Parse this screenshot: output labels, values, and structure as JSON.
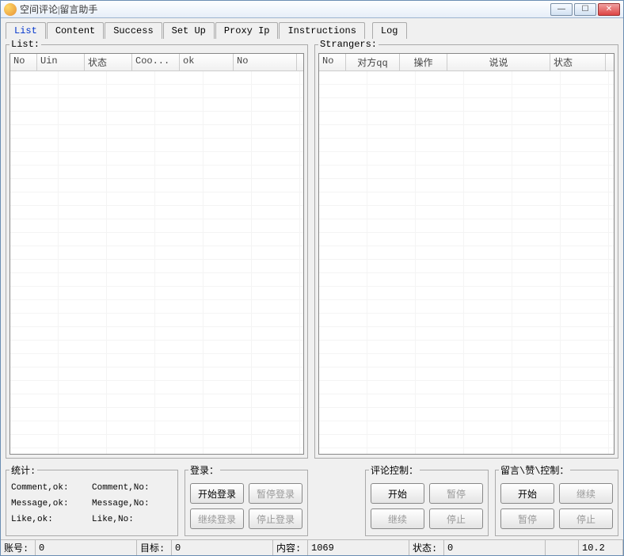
{
  "window": {
    "title": "空间评论|留言助手"
  },
  "tabs": [
    {
      "label": "List",
      "active": true
    },
    {
      "label": "Content"
    },
    {
      "label": "Success"
    },
    {
      "label": "Set Up"
    },
    {
      "label": "Proxy Ip"
    },
    {
      "label": "Instructions"
    },
    {
      "label": "Log",
      "gap": true
    }
  ],
  "listGroup": {
    "legend": "List:",
    "columns": [
      "No",
      "Uin",
      "状态",
      "Coo...",
      "ok",
      "No"
    ]
  },
  "strangersGroup": {
    "legend": "Strangers:",
    "columns": [
      "No",
      "对方qq",
      "操作",
      "说说",
      "状态"
    ]
  },
  "stats": {
    "legend": "统计:",
    "rows": [
      {
        "l": "Comment,ok:",
        "r": "Comment,No:"
      },
      {
        "l": "Message,ok:",
        "r": "Message,No:"
      },
      {
        "l": "Like,ok:",
        "r": "Like,No:"
      }
    ]
  },
  "login": {
    "legend": "登录：",
    "buttons": [
      {
        "label": "开始登录",
        "enabled": true
      },
      {
        "label": "暂停登录",
        "enabled": false
      },
      {
        "label": "继续登录",
        "enabled": false
      },
      {
        "label": "停止登录",
        "enabled": false
      }
    ]
  },
  "commentCtrl": {
    "legend": "评论控制：",
    "buttons": [
      {
        "label": "开始",
        "enabled": true
      },
      {
        "label": "暂停",
        "enabled": false
      },
      {
        "label": "继续",
        "enabled": false
      },
      {
        "label": "停止",
        "enabled": false
      }
    ]
  },
  "msgCtrl": {
    "legend": "留言\\赞\\控制：",
    "buttons": [
      {
        "label": "开始",
        "enabled": true
      },
      {
        "label": "继续",
        "enabled": false
      },
      {
        "label": "暂停",
        "enabled": false
      },
      {
        "label": "停止",
        "enabled": false
      }
    ]
  },
  "statusbar": {
    "account_label": "账号:",
    "account": "0",
    "target_label": "目标:",
    "target": "0",
    "content_label": "内容:",
    "content": "1069",
    "state_label": "状态:",
    "state": "0",
    "version": "10.2"
  }
}
